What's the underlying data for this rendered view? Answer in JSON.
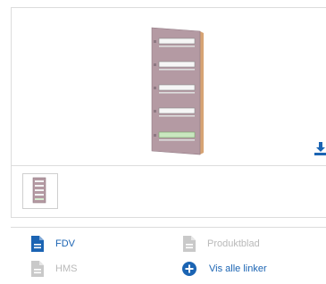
{
  "links": {
    "fdv": "FDV",
    "produktblad": "Produktblad",
    "hms": "HMS",
    "vis_alle": "Vis alle linker"
  },
  "colors": {
    "accent": "#1b64b3",
    "disabled": "#b9b9b9",
    "cabinet": "#b49aa3",
    "border": "#dcdcdc"
  },
  "icons": {
    "download": "download-icon",
    "document": "document-icon",
    "plus": "plus-circle-icon"
  }
}
